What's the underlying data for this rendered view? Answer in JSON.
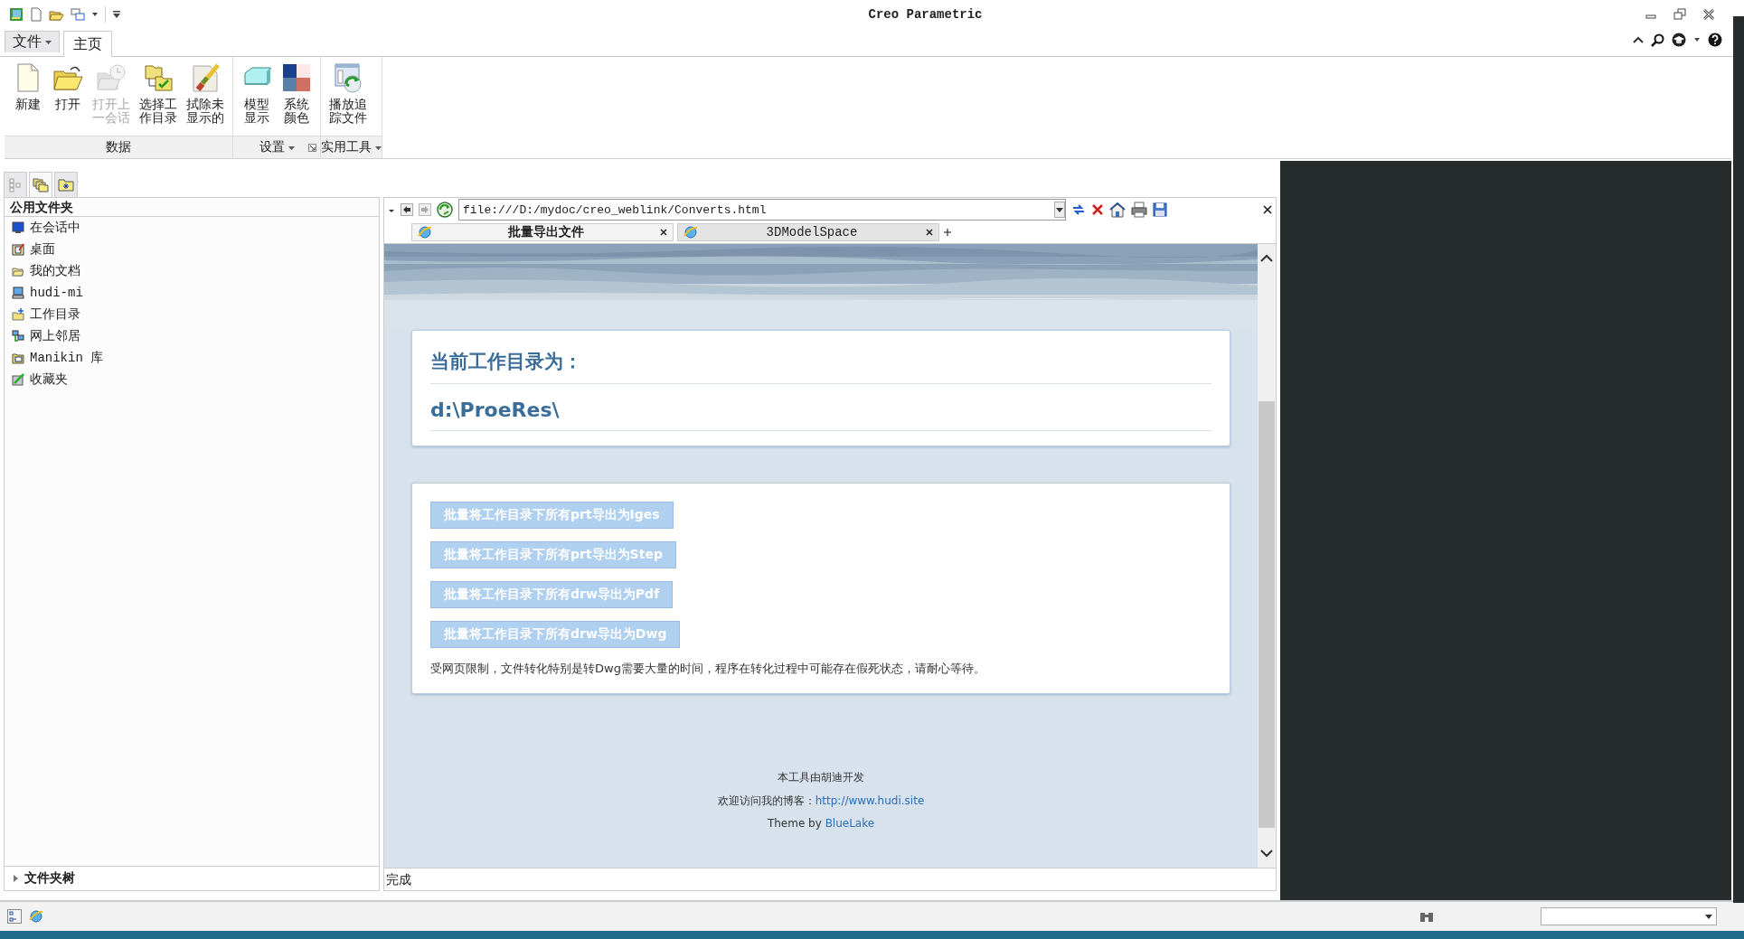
{
  "window": {
    "title": "Creo Parametric"
  },
  "ribbon_tabs": [
    {
      "label": "文件",
      "selected": false,
      "has_menu": true
    },
    {
      "label": "主页",
      "selected": true,
      "has_menu": false
    }
  ],
  "ribbon_groups": [
    {
      "label": "数据",
      "has_menu": false,
      "has_launcher": false,
      "buttons": [
        {
          "lines": [
            "新建"
          ],
          "disabled": false
        },
        {
          "lines": [
            "打开"
          ],
          "disabled": false
        },
        {
          "lines": [
            "打开上",
            "一会话"
          ],
          "disabled": true
        },
        {
          "lines": [
            "选择工",
            "作目录"
          ],
          "disabled": false
        },
        {
          "lines": [
            "拭除未",
            "显示的"
          ],
          "disabled": false
        }
      ]
    },
    {
      "label": "设置",
      "has_menu": true,
      "has_launcher": true,
      "buttons": [
        {
          "lines": [
            "模型",
            "显示"
          ],
          "disabled": false
        },
        {
          "lines": [
            "系统",
            "颜色"
          ],
          "disabled": false
        }
      ]
    },
    {
      "label": "实用工具",
      "has_menu": true,
      "has_launcher": false,
      "buttons": [
        {
          "lines": [
            "播放追",
            "踪文件"
          ],
          "disabled": false
        }
      ]
    }
  ],
  "left_panel": {
    "tabs": [
      {
        "selected": false
      },
      {
        "selected": true
      },
      {
        "selected": false
      }
    ],
    "header": "公用文件夹",
    "items": [
      {
        "label": "在会话中"
      },
      {
        "label": "桌面"
      },
      {
        "label": "我的文档"
      },
      {
        "label": "hudi-mi"
      },
      {
        "label": "工作目录"
      },
      {
        "label": "网上邻居"
      },
      {
        "label": "Manikin 库"
      },
      {
        "label": "收藏夹"
      }
    ],
    "footer": {
      "label": "文件夹树",
      "expanded": false
    }
  },
  "browser": {
    "address": "file:///D:/mydoc/creo_weblink/Converts.html",
    "tabs": [
      {
        "label": "批量导出文件",
        "selected": true
      },
      {
        "label": "3DModelSpace",
        "selected": false
      }
    ],
    "page": {
      "heading": "当前工作目录为：",
      "directory": "d:\\ProeRes\\",
      "buttons": [
        "批量将工作目录下所有prt导出为Iges",
        "批量将工作目录下所有prt导出为Step",
        "批量将工作目录下所有drw导出为Pdf",
        "批量将工作目录下所有drw导出为Dwg"
      ],
      "note": "受网页限制，文件转化特别是转Dwg需要大量的时间，程序在转化过程中可能存在假死状态，请耐心等待。",
      "footer": {
        "credit": "本工具由胡迪开发",
        "blog_prefix": "欢迎访问我的博客：",
        "blog_link": "http://www.hudi.site",
        "theme_prefix": "Theme by ",
        "theme_link": "BlueLake"
      }
    },
    "status": "完成"
  }
}
